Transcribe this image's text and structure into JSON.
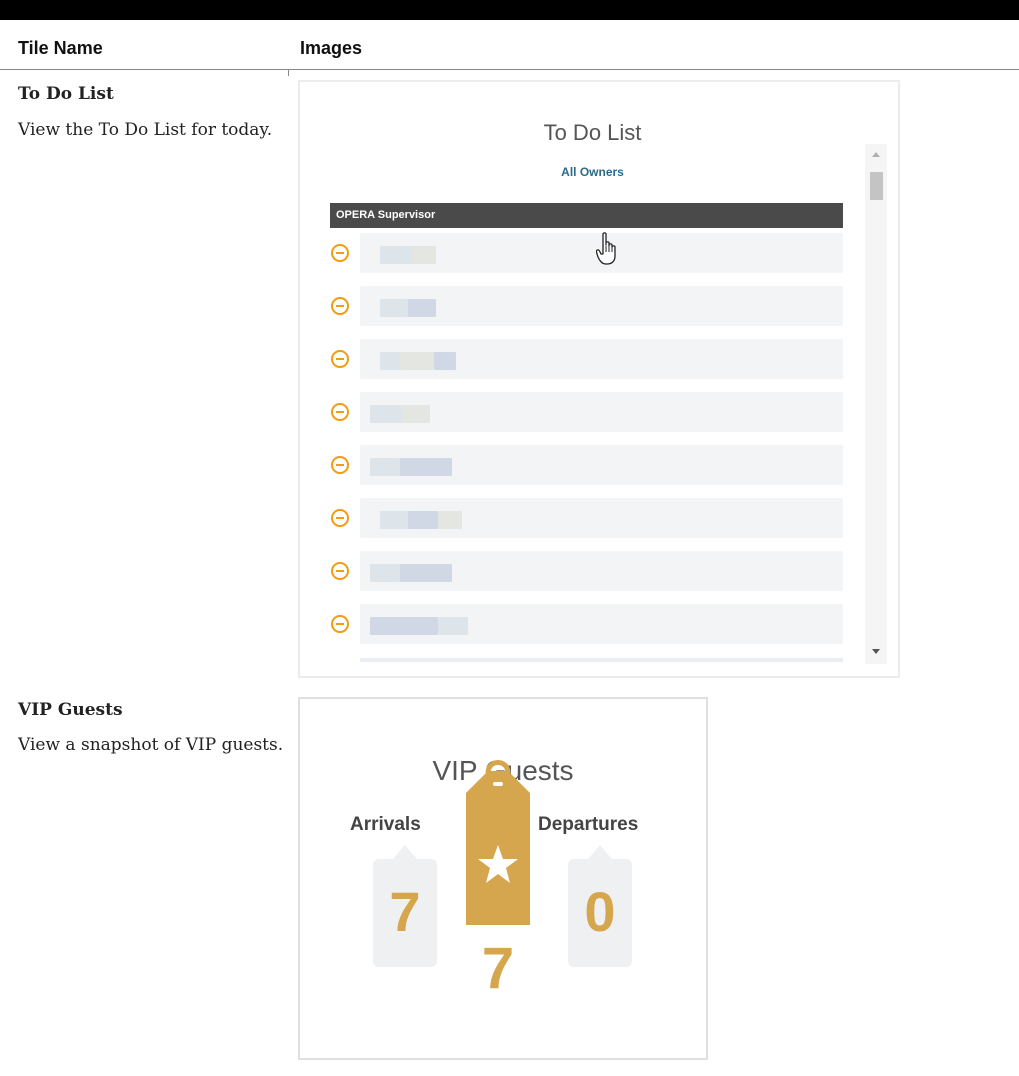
{
  "table": {
    "headers": [
      "Tile Name",
      "Images"
    ]
  },
  "rows": [
    {
      "name": "To Do List",
      "description": "View the To Do List for today.",
      "tile": {
        "title": "To Do List",
        "owner_filter": "All Owners",
        "group": "OPERA Supervisor",
        "item_icon": "minus-circle-icon",
        "item_count": 8
      }
    },
    {
      "name": "VIP Guests",
      "description": "View a snapshot of VIP guests.",
      "tile": {
        "title": "VIP Guests",
        "arrivals_label": "Arrivals",
        "arrivals_value": "7",
        "departures_label": "Departures",
        "departures_value": "0",
        "total_value": "7",
        "accent_color": "#d6a64e"
      }
    }
  ]
}
